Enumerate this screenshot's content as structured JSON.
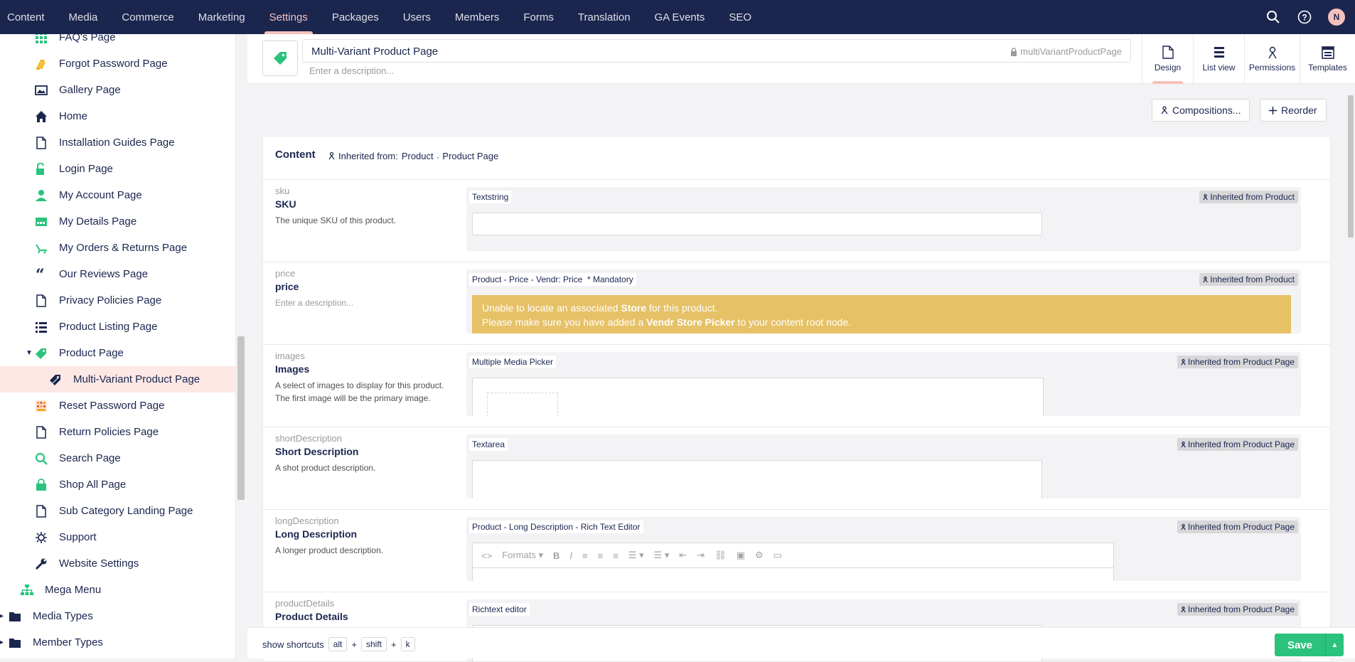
{
  "nav": {
    "sections": [
      "Content",
      "Media",
      "Commerce",
      "Marketing",
      "Settings",
      "Packages",
      "Users",
      "Members",
      "Forms",
      "Translation",
      "GA Events",
      "SEO"
    ],
    "active": "Settings",
    "user_initial": "N"
  },
  "tree": {
    "items": [
      {
        "label": "FAQ's Page",
        "icon": "grid-icon",
        "color": "#2bc37c"
      },
      {
        "label": "Forgot Password Page",
        "icon": "key-icon",
        "color": "#f0ac00"
      },
      {
        "label": "Gallery Page",
        "icon": "image-icon",
        "color": "#1b264f"
      },
      {
        "label": "Home",
        "icon": "home-icon",
        "color": "#1b264f"
      },
      {
        "label": "Installation Guides Page",
        "icon": "document-icon",
        "color": "#1b264f"
      },
      {
        "label": "Login Page",
        "icon": "unlock-icon",
        "color": "#2bc37c"
      },
      {
        "label": "My Account Page",
        "icon": "user-icon",
        "color": "#2bc37c"
      },
      {
        "label": "My Details Page",
        "icon": "card-icon",
        "color": "#2bc37c"
      },
      {
        "label": "My Orders & Returns Page",
        "icon": "truck-icon",
        "color": "#2bc37c"
      },
      {
        "label": "Our Reviews Page",
        "icon": "quote-icon",
        "color": "#1b264f"
      },
      {
        "label": "Privacy Policies Page",
        "icon": "document-icon",
        "color": "#1b264f"
      },
      {
        "label": "Product Listing Page",
        "icon": "list-icon",
        "color": "#1b264f"
      },
      {
        "label": "Product Page",
        "icon": "tag-icon",
        "color": "#2bc37c"
      },
      {
        "label": "Multi-Variant Product Page",
        "icon": "tags-icon",
        "color": "#1b264f"
      },
      {
        "label": "Reset Password Page",
        "icon": "keypad-icon",
        "color": "#f5a623"
      },
      {
        "label": "Return Policies Page",
        "icon": "document-icon",
        "color": "#1b264f"
      },
      {
        "label": "Search Page",
        "icon": "search-icon",
        "color": "#2bc37c"
      },
      {
        "label": "Shop All Page",
        "icon": "bag-icon",
        "color": "#2bc37c"
      },
      {
        "label": "Sub Category Landing Page",
        "icon": "document-icon",
        "color": "#1b264f"
      },
      {
        "label": "Support",
        "icon": "lifebuoy-icon",
        "color": "#1b264f"
      },
      {
        "label": "Website Settings",
        "icon": "wrench-icon",
        "color": "#1b264f"
      },
      {
        "label": "Mega Menu",
        "icon": "sitemap-icon",
        "color": "#2bc37c"
      },
      {
        "label": "Media Types",
        "icon": "folder-icon",
        "color": "#1b264f"
      },
      {
        "label": "Member Types",
        "icon": "folder-icon",
        "color": "#1b264f"
      }
    ]
  },
  "header": {
    "name": "Multi-Variant Product Page",
    "alias": "multiVariantProductPage",
    "description_placeholder": "Enter a description...",
    "apps": [
      "Design",
      "List view",
      "Permissions",
      "Templates"
    ]
  },
  "toolbar": {
    "compositions": "Compositions...",
    "reorder": "Reorder"
  },
  "group": {
    "title": "Content",
    "inherited_label": "Inherited from:",
    "inherited_from": [
      "Product",
      "Product Page"
    ]
  },
  "properties": [
    {
      "alias": "sku",
      "label": "SKU",
      "description": "The unique SKU of this product.",
      "editor": "Textstring",
      "inherited": "Inherited from Product"
    },
    {
      "alias": "price",
      "label": "price",
      "description": "Enter a description...",
      "editor": "Product - Price - Vendr: Price",
      "mandatory": "* Mandatory",
      "inherited": "Inherited from Product",
      "warning_line1_a": "Unable to locate an associated ",
      "warning_line1_b": "Store",
      "warning_line1_c": " for this product.",
      "warning_line2_a": "Please make sure you have added a ",
      "warning_line2_b": "Vendr Store Picker",
      "warning_line2_c": " to your content root node."
    },
    {
      "alias": "images",
      "label": "Images",
      "description": "A select of images to display for this product.",
      "description2": "The first image will be the primary image.",
      "editor": "Multiple Media Picker",
      "inherited": "Inherited from Product Page"
    },
    {
      "alias": "shortDescription",
      "label": "Short Description",
      "description": "A shot product description.",
      "editor": "Textarea",
      "inherited": "Inherited from Product Page"
    },
    {
      "alias": "longDescription",
      "label": "Long Description",
      "description": "A longer product description.",
      "editor": "Product - Long Description - Rich Text Editor",
      "inherited": "Inherited from Product Page",
      "formats": "Formats"
    },
    {
      "alias": "productDetails",
      "label": "Product Details",
      "description": "",
      "editor": "Richtext editor",
      "inherited": "Inherited from Product Page"
    }
  ],
  "footer": {
    "shortcuts": "show shortcuts",
    "keys": [
      "alt",
      "shift",
      "k"
    ],
    "plus": "+",
    "save": "Save"
  },
  "colors": {
    "nav_bg": "#1b264f",
    "accent": "#f5c1bc",
    "save": "#2bc37c",
    "warning": "#e6c166"
  }
}
